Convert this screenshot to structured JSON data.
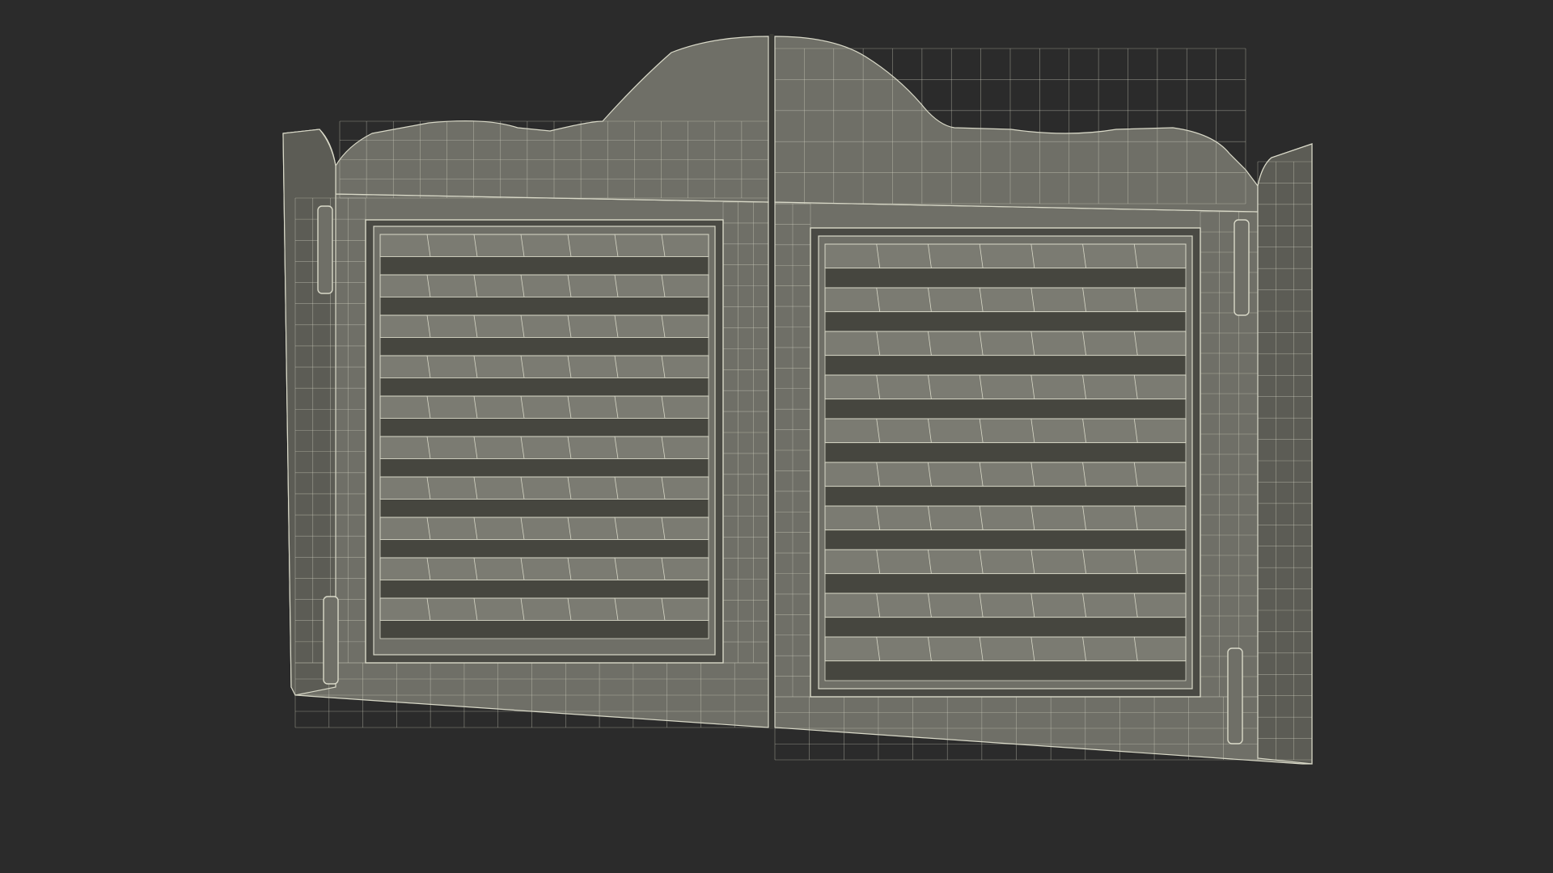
{
  "scene": {
    "subject": "saloon-swinging-doors-wireframe",
    "colors": {
      "background": "#2b2b2b",
      "panel": "#6f6f67",
      "panel_shade": "#5c5c55",
      "panel_dark": "#4a4a44",
      "wire": "#d9d9c8",
      "louver_light": "#7b7b72",
      "louver_dark": "#46463f"
    },
    "doors": [
      {
        "name": "left-door",
        "louvers": 10,
        "hinges": 2
      },
      {
        "name": "right-door",
        "louvers": 10,
        "hinges": 2
      }
    ]
  }
}
